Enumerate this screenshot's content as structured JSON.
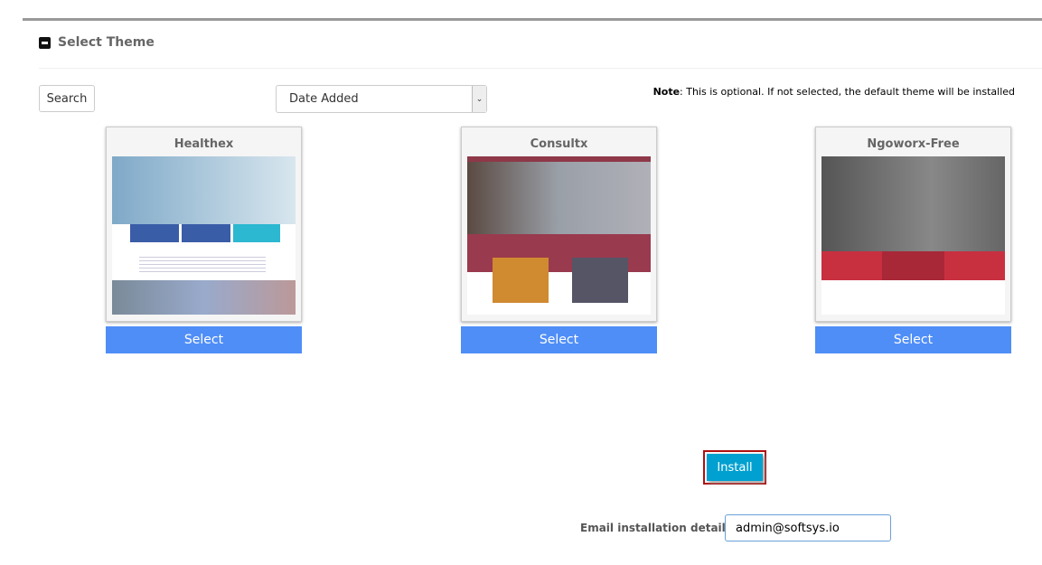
{
  "section": {
    "title": "Select Theme"
  },
  "toolbar": {
    "search_label": "Search",
    "sort_value": "Date Added",
    "note_bold": "Note",
    "note_text": ": This is optional. If not selected, the default theme will be installed"
  },
  "themes": [
    {
      "name": "Healthex",
      "select_label": "Select"
    },
    {
      "name": "Consultx",
      "select_label": "Select"
    },
    {
      "name": "Ngoworx-Free",
      "select_label": "Select"
    }
  ],
  "install": {
    "label": "Install"
  },
  "email": {
    "label": "Email installation details to :",
    "value": "admin@softsys.io"
  },
  "colors": {
    "select_button": "#4f8ef7",
    "install_button": "#00a0d0",
    "install_highlight": "#b01010"
  }
}
